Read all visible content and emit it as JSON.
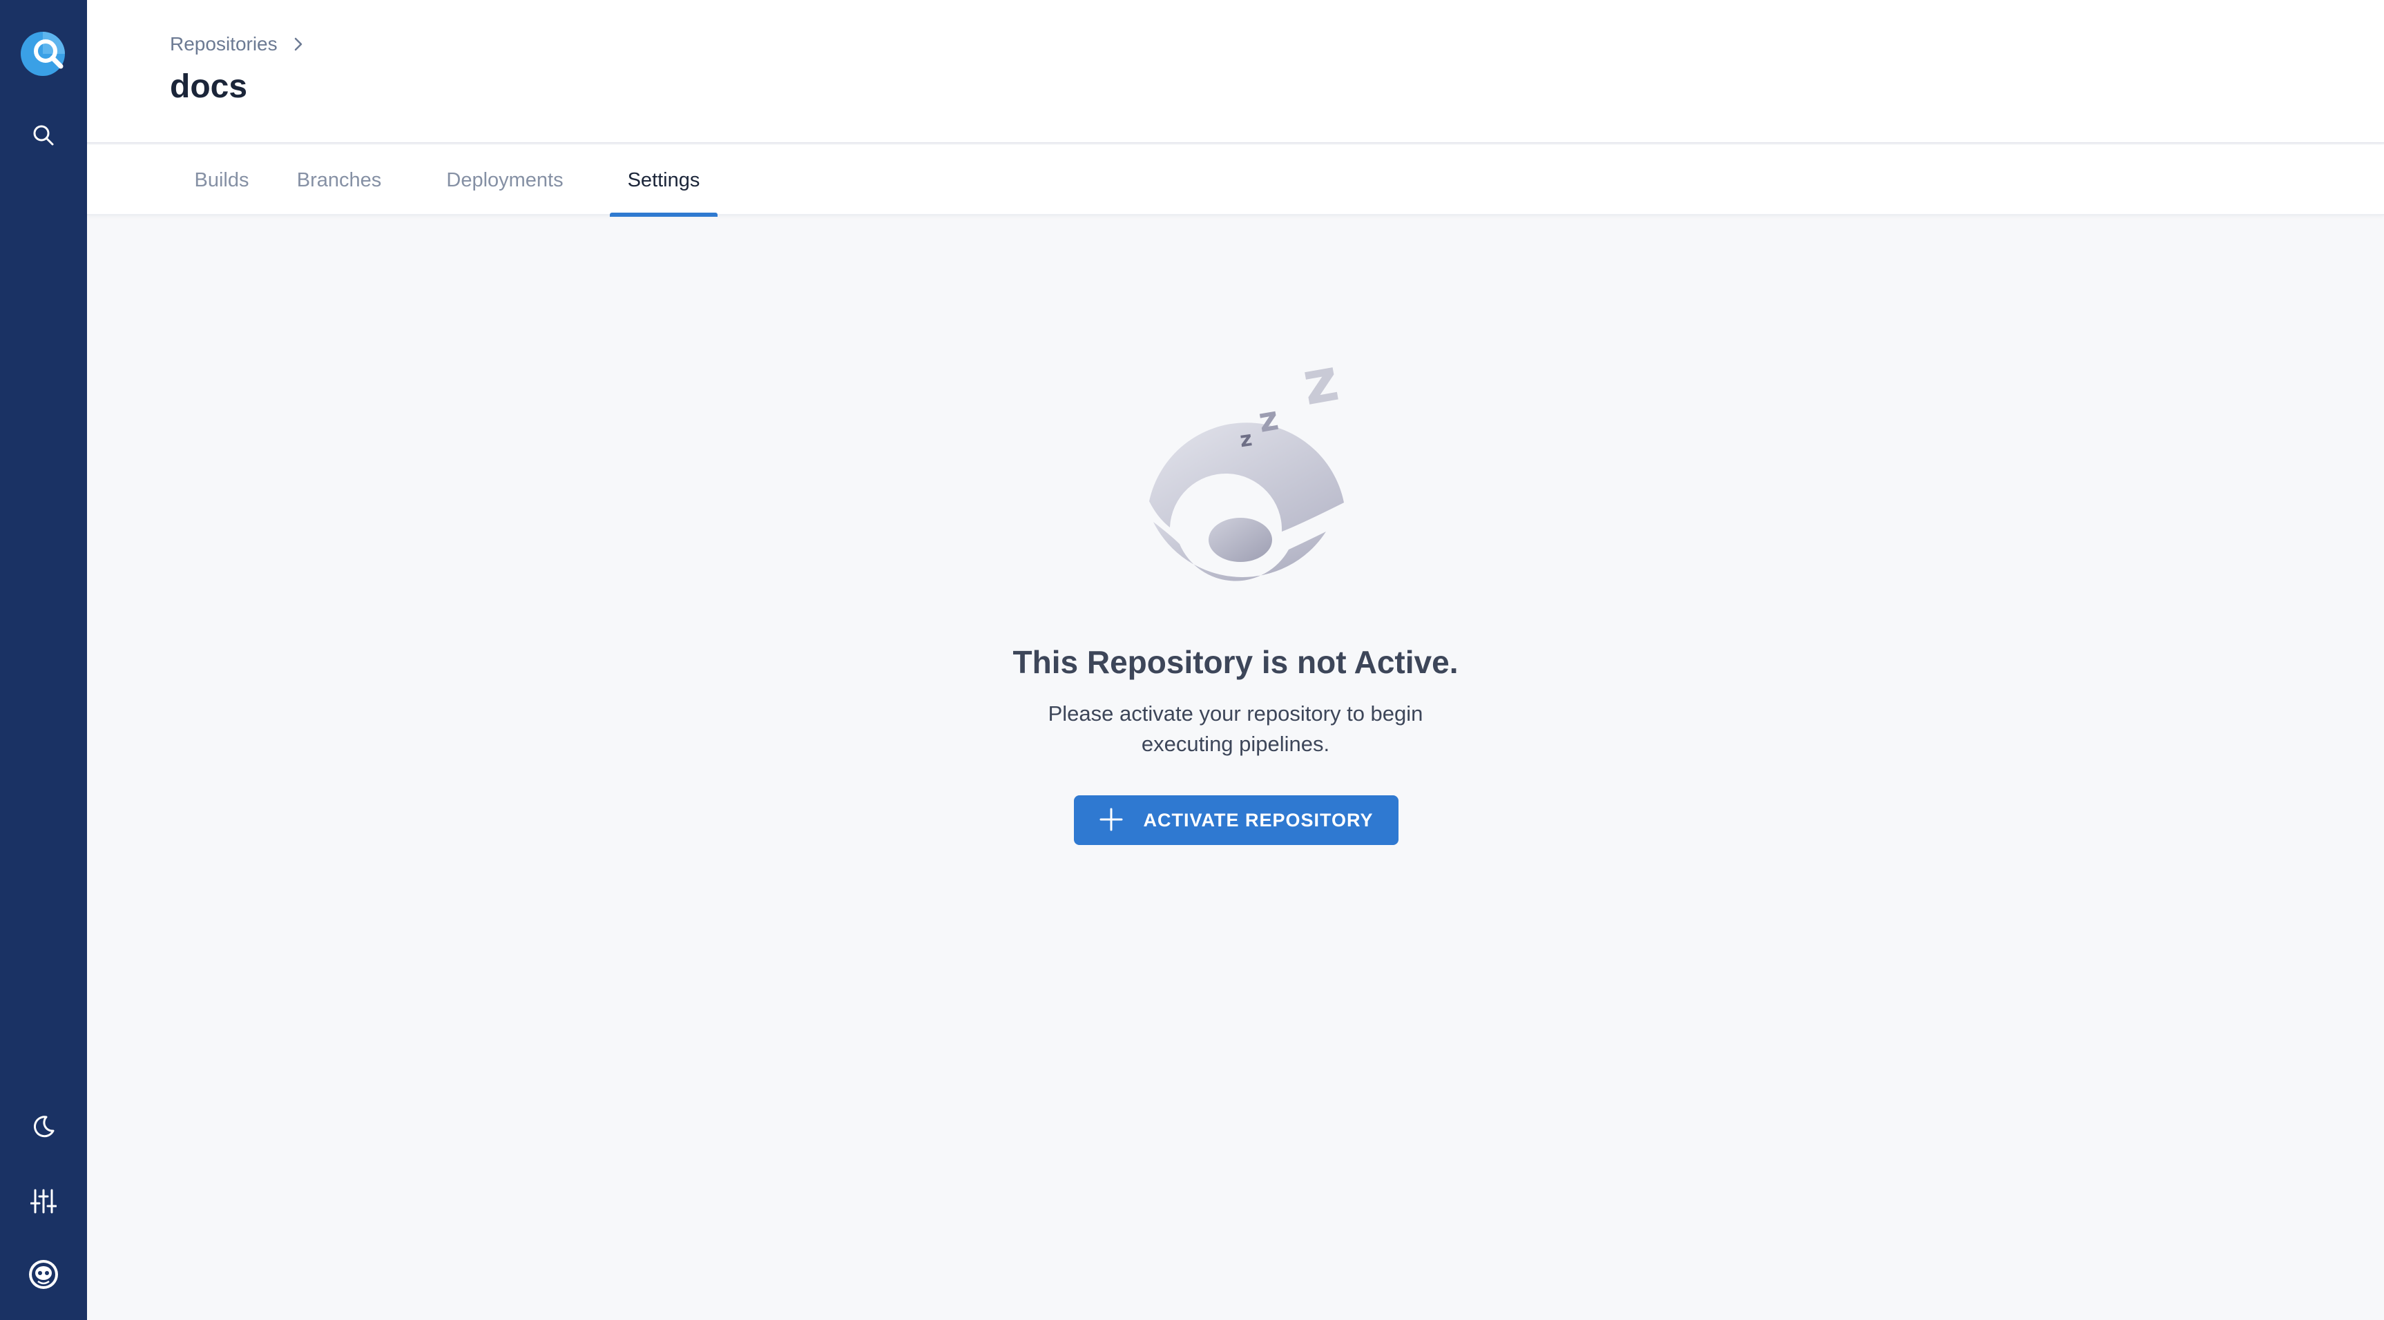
{
  "sidebar": {
    "logo": "drone-logo",
    "top_items": [
      {
        "name": "search",
        "icon": "search-icon"
      }
    ],
    "bottom_items": [
      {
        "name": "theme-toggle",
        "icon": "moon-icon"
      },
      {
        "name": "settings",
        "icon": "sliders-icon"
      },
      {
        "name": "user",
        "icon": "avatar-icon"
      }
    ],
    "bg_color": "#1a3264"
  },
  "header": {
    "breadcrumb": {
      "items": [
        {
          "label": "Repositories"
        }
      ]
    },
    "title": "docs"
  },
  "tabs": {
    "items": [
      {
        "label": "Builds",
        "active": false
      },
      {
        "label": "Branches",
        "active": false
      },
      {
        "label": "Deployments",
        "active": false
      },
      {
        "label": "Settings",
        "active": true
      }
    ],
    "accent_color": "#2f7ad0"
  },
  "empty_state": {
    "illustration": "sleeping-drone-icon",
    "title": "This Repository is not Active.",
    "description": "Please activate your repository to begin executing pipelines.",
    "button": {
      "label": "ACTIVATE REPOSITORY",
      "icon": "plus-icon",
      "color": "#2f79d1"
    }
  }
}
